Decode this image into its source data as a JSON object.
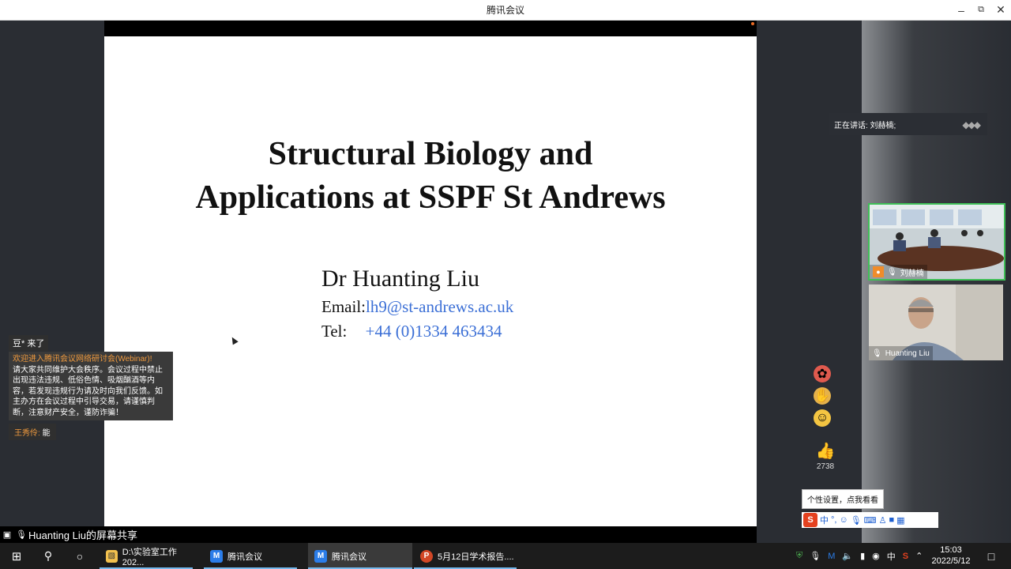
{
  "window": {
    "title": "腾讯会议"
  },
  "slide": {
    "title_line1": "Structural Biology and",
    "title_line2": "Applications at SSPF St Andrews",
    "presenter_name": "Dr Huanting Liu",
    "email_label": "Email:",
    "email_value": "lh9@st-andrews.ac.uk",
    "tel_label": "Tel:",
    "tel_value": "+44 (0)1334 463434"
  },
  "chat": {
    "joined": "豆* 来了",
    "notice_highlight": "欢迎进入腾讯会议网络研讨会(Webinar)!",
    "notice_body": "请大家共同维护大会秩序。会议过程中禁止出现违法违规、低俗色情、吸烟酗酒等内容，若发现违规行为请及时向我们反馈。如主办方在会议过程中引导交易，请谨慎判断，注意财产安全，谨防诈骗！",
    "msg_author": "王秀伶:",
    "msg_text": "能"
  },
  "share_bar": {
    "text": "Huanting Liu的屏幕共享"
  },
  "speaking": {
    "text": "正在讲话: 刘赫楠;"
  },
  "videos": [
    {
      "name": "刘赫楠"
    },
    {
      "name": "Huanting Liu"
    }
  ],
  "reactions": {
    "like_count": "2738"
  },
  "tooltip": {
    "text": "个性设置，点我看看"
  },
  "ime": {
    "mode": "中",
    "punct": "°,"
  },
  "taskbar": {
    "apps": [
      {
        "label": "D:\\实验室工作202...",
        "icon": "folder-icon"
      },
      {
        "label": "腾讯会议",
        "icon": "tencent-meeting-icon"
      },
      {
        "label": "腾讯会议",
        "icon": "tencent-meeting-icon"
      },
      {
        "label": "5月12日学术报告....",
        "icon": "powerpoint-icon"
      }
    ],
    "ime_indicator": "中",
    "time": "15:03",
    "date": "2022/5/12"
  }
}
